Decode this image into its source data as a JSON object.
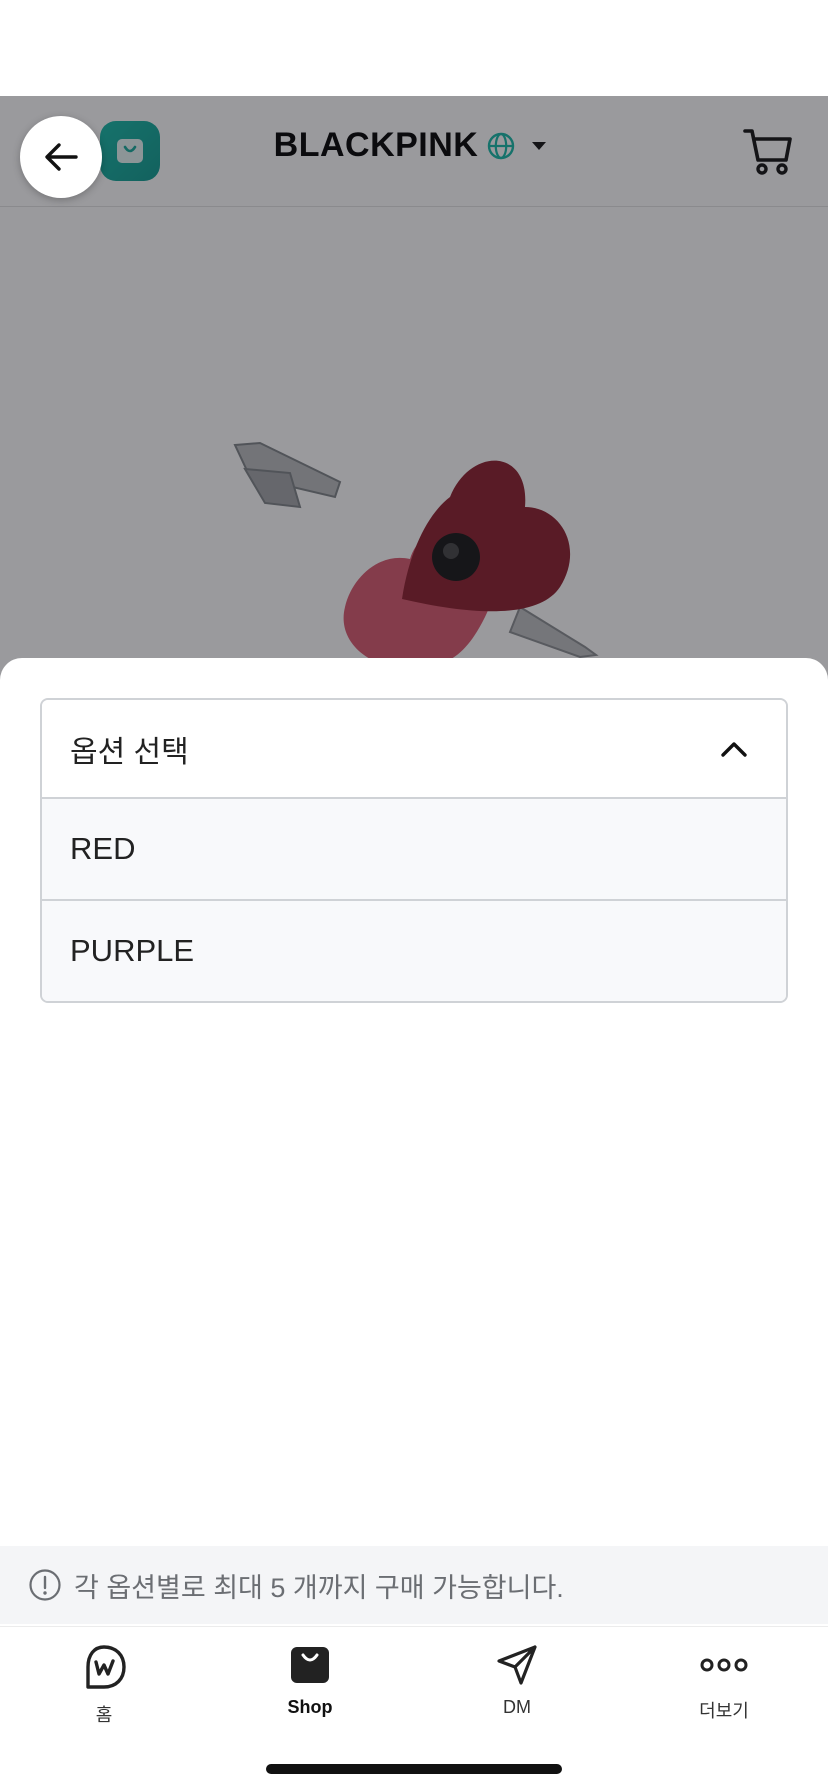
{
  "header": {
    "brand": "BLACKPINK"
  },
  "sheet": {
    "select_title": "옵션 선택",
    "options": [
      "RED",
      "PURPLE"
    ]
  },
  "notice": {
    "text": "각 옵션별로 최대 5 개까지 구매 가능합니다."
  },
  "nav": {
    "items": [
      {
        "label": "홈",
        "icon": "weverse-home-icon"
      },
      {
        "label": "Shop",
        "icon": "shop-bag-icon",
        "active": true
      },
      {
        "label": "DM",
        "icon": "send-icon"
      },
      {
        "label": "더보기",
        "icon": "more-dots-icon"
      }
    ]
  },
  "colors": {
    "accent": "#14b8a6",
    "overlay": "#18182070",
    "heart_red": "#8b1e2b",
    "heart_pink": "#d8586d"
  }
}
